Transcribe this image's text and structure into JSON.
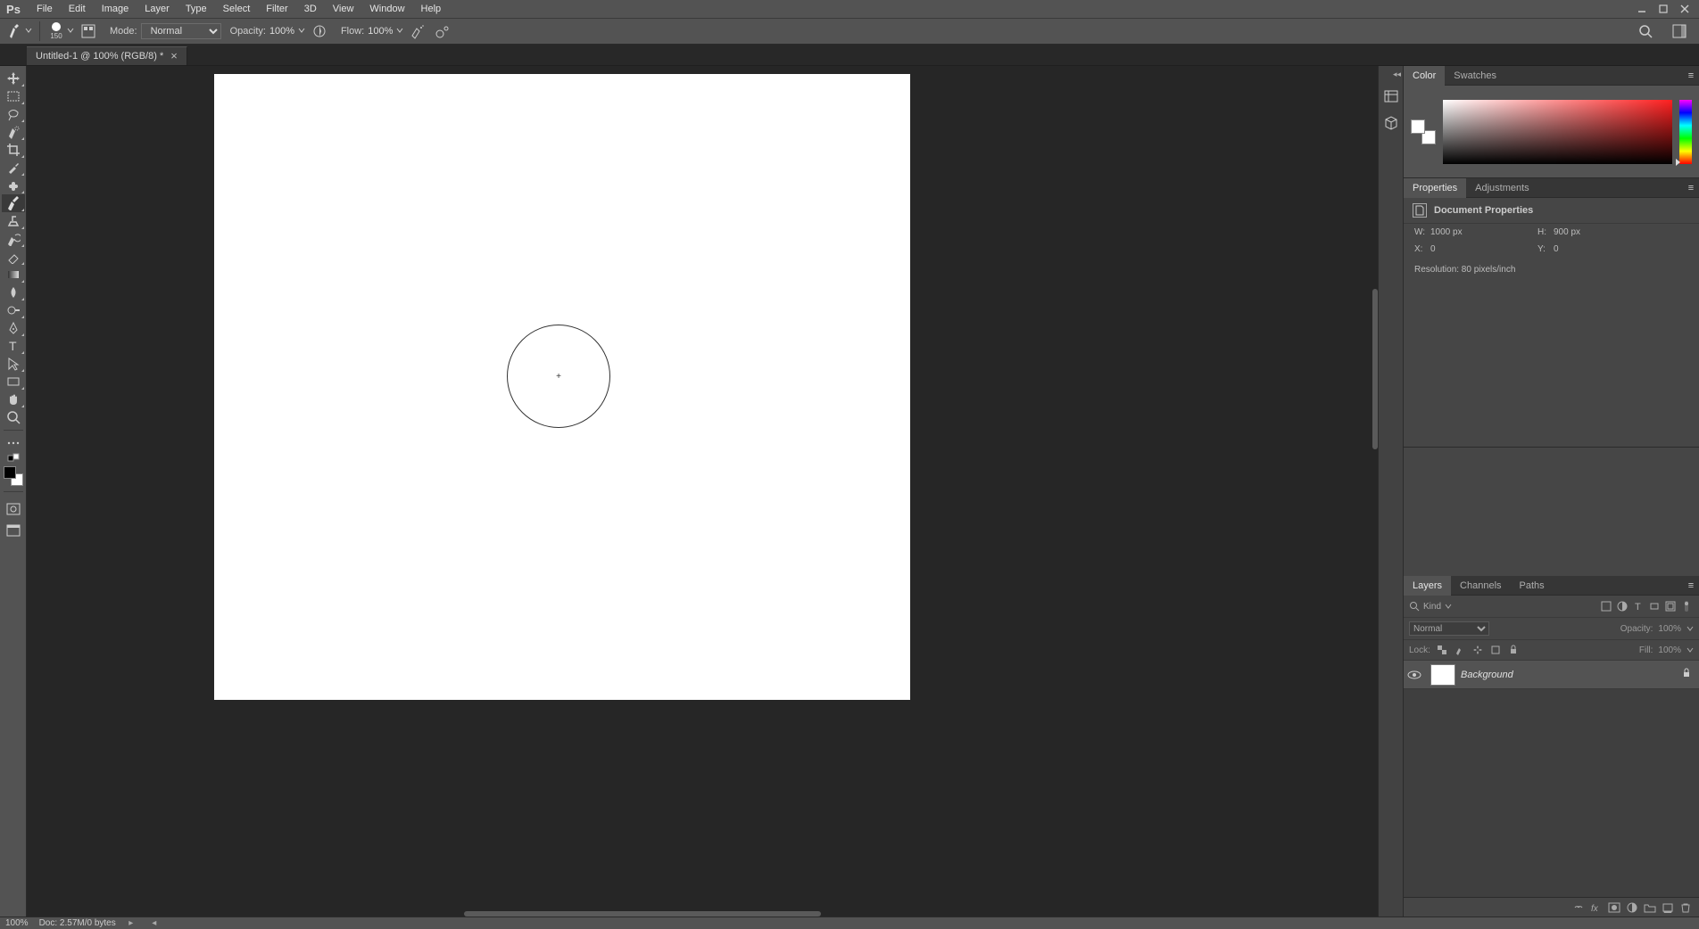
{
  "app": {
    "logo": "Ps"
  },
  "menu": [
    "File",
    "Edit",
    "Image",
    "Layer",
    "Type",
    "Select",
    "Filter",
    "3D",
    "View",
    "Window",
    "Help"
  ],
  "options": {
    "brush_size": "150",
    "mode_label": "Mode:",
    "mode_value": "Normal",
    "opacity_label": "Opacity:",
    "opacity_value": "100%",
    "flow_label": "Flow:",
    "flow_value": "100%"
  },
  "doc_tab": {
    "title": "Untitled-1 @ 100% (RGB/8) *"
  },
  "panels": {
    "color": {
      "tabs": [
        "Color",
        "Swatches"
      ],
      "active": 0
    },
    "properties": {
      "tabs": [
        "Properties",
        "Adjustments"
      ],
      "active": 0,
      "title": "Document Properties",
      "w_label": "W:",
      "w_value": "1000 px",
      "h_label": "H:",
      "h_value": "900 px",
      "x_label": "X:",
      "x_value": "0",
      "y_label": "Y:",
      "y_value": "0",
      "resolution": "Resolution: 80 pixels/inch"
    },
    "layers": {
      "tabs": [
        "Layers",
        "Channels",
        "Paths"
      ],
      "active": 0,
      "kind_label": "Kind",
      "blend_mode": "Normal",
      "opacity_label": "Opacity:",
      "opacity_value": "100%",
      "lock_label": "Lock:",
      "fill_label": "Fill:",
      "fill_value": "100%",
      "layer_name": "Background"
    }
  },
  "status": {
    "zoom": "100%",
    "doc": "Doc: 2.57M/0 bytes"
  }
}
